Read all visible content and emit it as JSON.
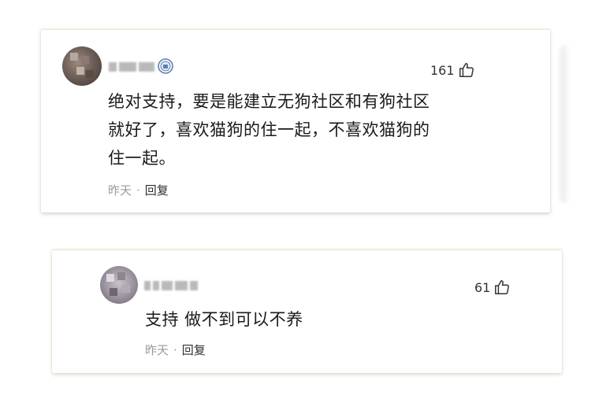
{
  "comments": [
    {
      "username_blurred": true,
      "has_badge": true,
      "badge_icon": "shield-badge-icon",
      "likes": "161",
      "like_icon": "thumbs-up-icon",
      "text": "绝对支持，要是能建立无狗社区和有狗社区\n就好了，喜欢猫狗的住一起，不喜欢猫狗的\n住一起。",
      "time": "昨天",
      "separator": "·",
      "reply_label": "回复"
    },
    {
      "username_blurred": true,
      "has_badge": false,
      "likes": "61",
      "like_icon": "thumbs-up-icon",
      "text": "支持 做不到可以不养",
      "time": "昨天",
      "separator": "·",
      "reply_label": "回复"
    }
  ],
  "colors": {
    "background": "#ffffff",
    "text": "#1a1a1a",
    "meta_text": "#9b9b9b",
    "card_border": "#f1ead2"
  }
}
